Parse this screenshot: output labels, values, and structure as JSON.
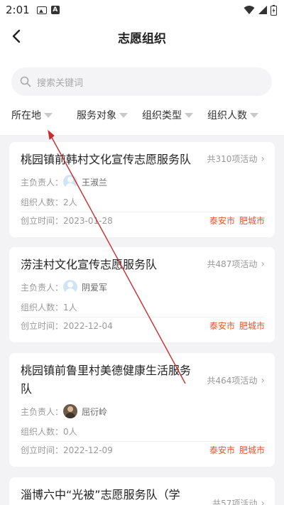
{
  "status_bar": {
    "time": "2:01"
  },
  "header": {
    "title": "志愿组织"
  },
  "search": {
    "placeholder": "搜索关键词"
  },
  "filters": [
    {
      "label": "所在地"
    },
    {
      "label": "服务对象"
    },
    {
      "label": "组织类型"
    },
    {
      "label": "组织人数"
    }
  ],
  "labels": {
    "leader": "主负责人：",
    "members": "组织人数：",
    "created": "创立时间："
  },
  "cards": [
    {
      "title": "桃园镇前韩村文化宣传志愿服务队",
      "count": "共310项活动",
      "leader": "王淑兰",
      "members": "2人",
      "created": "2023-01-28",
      "tags": [
        "泰安市",
        "肥城市"
      ]
    },
    {
      "title": "涝洼村文化宣传志愿服务队",
      "count": "共487项活动",
      "leader": "阴爱军",
      "members": "1人",
      "created": "2022-12-04",
      "tags": [
        "泰安市",
        "肥城市"
      ]
    },
    {
      "title": "桃园镇前鲁里村美德健康生活服务队",
      "count": "共464项活动",
      "leader": "屈衍岭",
      "members": "0人",
      "created": "2022-12-09",
      "tags": [
        "泰安市",
        "肥城市"
      ]
    },
    {
      "title": "淄博六中“光被”志愿服务队（学",
      "count": "共57项活动"
    }
  ],
  "colors": {
    "accent": "#e0552e",
    "annotation_arrow": "#cc2b2b"
  }
}
